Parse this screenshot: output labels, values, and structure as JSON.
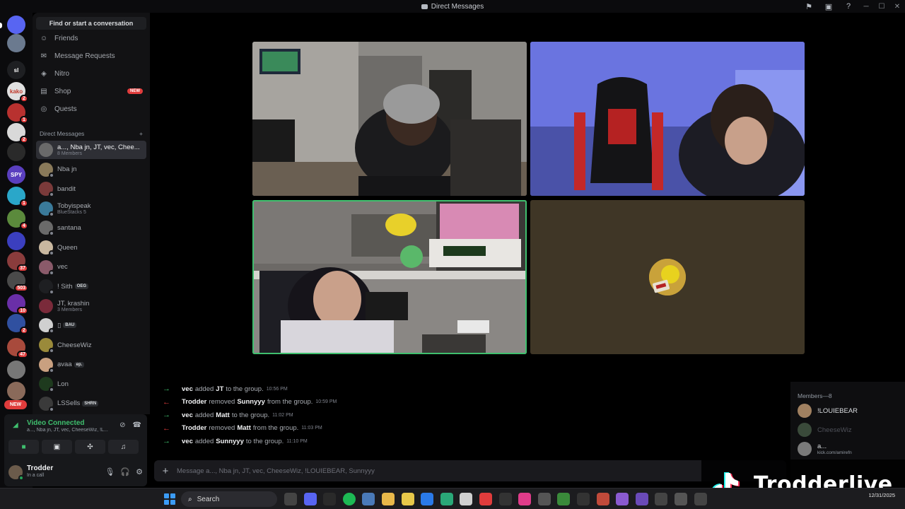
{
  "window": {
    "title": "Direct Messages"
  },
  "rail": {
    "servers": [
      {
        "label": "",
        "color": "#5865f2",
        "badge": ""
      },
      {
        "label": "",
        "color": "#6b7a8f",
        "badge": ""
      },
      {
        "label": "sl",
        "color": "#1e1f22",
        "badge": ""
      },
      {
        "label": "kako",
        "color": "#e0e0e0",
        "badge": "2"
      },
      {
        "label": "",
        "color": "#b8312f",
        "badge": "1"
      },
      {
        "label": "",
        "color": "#d9d9d9",
        "badge": "2"
      },
      {
        "label": "",
        "color": "#2a2a2a",
        "badge": ""
      },
      {
        "label": "SPY",
        "color": "#5a3fbf",
        "badge": ""
      },
      {
        "label": "",
        "color": "#2aa7c9",
        "badge": "1"
      },
      {
        "label": "",
        "color": "#5b8a3c",
        "badge": "4"
      },
      {
        "label": "",
        "color": "#3b3fbf",
        "badge": ""
      },
      {
        "label": "",
        "color": "#8a3c3c",
        "badge": "37"
      },
      {
        "label": "",
        "color": "#4a4a4a",
        "badge": "503"
      },
      {
        "label": "",
        "color": "#6a2fa8",
        "badge": "10"
      },
      {
        "label": "",
        "color": "#3050a0",
        "badge": "2"
      },
      {
        "label": "",
        "color": "#a84a3c",
        "badge": "47"
      },
      {
        "label": "",
        "color": "#777777",
        "badge": ""
      },
      {
        "label": "",
        "color": "#8a6a5a",
        "badge": ""
      }
    ],
    "new_label": "NEW"
  },
  "sidebar": {
    "search_placeholder": "Find or start a conversation",
    "nav": [
      {
        "label": "Friends",
        "icon": "friends-icon",
        "tag": ""
      },
      {
        "label": "Message Requests",
        "icon": "mail-icon",
        "tag": ""
      },
      {
        "label": "Nitro",
        "icon": "nitro-icon",
        "tag": ""
      },
      {
        "label": "Shop",
        "icon": "shop-icon",
        "tag": "NEW"
      },
      {
        "label": "Quests",
        "icon": "quests-icon",
        "tag": ""
      }
    ],
    "dm_header": "Direct Messages",
    "dms": [
      {
        "name": "a..., Nba jn, JT, vec, Chee...",
        "sub": "8 Members",
        "tag": "",
        "color": "#6a6a6a",
        "active": true
      },
      {
        "name": "Nba jn",
        "sub": "",
        "tag": "",
        "color": "#8a7a5a",
        "active": false
      },
      {
        "name": "bandit",
        "sub": "",
        "tag": "",
        "color": "#7a3a3a",
        "active": false
      },
      {
        "name": "Tobyispeak",
        "sub": "BlueStacks 5",
        "tag": "",
        "color": "#3a7a9a",
        "active": false
      },
      {
        "name": "santana",
        "sub": "",
        "tag": "",
        "color": "#6a6a6a",
        "active": false
      },
      {
        "name": "Queen",
        "sub": "",
        "tag": "",
        "color": "#c9b8a0",
        "active": false
      },
      {
        "name": "vec",
        "sub": "",
        "tag": "",
        "color": "#8a5a6a",
        "active": false
      },
      {
        "name": "! Sith",
        "sub": "",
        "tag": "OEG",
        "color": "#1e1f22",
        "active": false
      },
      {
        "name": "JT, krashin",
        "sub": "3 Members",
        "tag": "",
        "color": "#7a2a3a",
        "active": false
      },
      {
        "name": "▯",
        "sub": "",
        "tag": "BAU",
        "color": "#d0d0d0",
        "active": false
      },
      {
        "name": "CheeseWiz",
        "sub": "",
        "tag": "",
        "color": "#9a8a3a",
        "active": false
      },
      {
        "name": "ạvaa",
        "sub": "",
        "tag": "ep.",
        "color": "#c9a080",
        "active": false
      },
      {
        "name": "Lon",
        "sub": "",
        "tag": "",
        "color": "#1e3a1e",
        "active": false
      },
      {
        "name": "LSSells",
        "sub": "",
        "tag": "SHRN",
        "color": "#3a3a3a",
        "active": false
      }
    ]
  },
  "voice": {
    "status": "Video Connected",
    "channel": "a..., Nba jn, JT, vec, CheeseWiz, !L...",
    "buttons": [
      "camera-icon",
      "screen-share-icon",
      "activities-icon",
      "soundboard-icon"
    ]
  },
  "user": {
    "name": "Trodder",
    "status": "In a call"
  },
  "log": [
    {
      "dir": "in",
      "actor": "vec",
      "verb": "added",
      "target": "JT",
      "rest": "to the group.",
      "time": "10:56 PM"
    },
    {
      "dir": "out",
      "actor": "Trodder",
      "verb": "removed",
      "target": "Sunnyyy",
      "rest": "from the group.",
      "time": "10:59 PM"
    },
    {
      "dir": "in",
      "actor": "vec",
      "verb": "added",
      "target": "Matt",
      "rest": "to the group.",
      "time": "11:02 PM"
    },
    {
      "dir": "out",
      "actor": "Trodder",
      "verb": "removed",
      "target": "Matt",
      "rest": "from the group.",
      "time": "11:03 PM"
    },
    {
      "dir": "in",
      "actor": "vec",
      "verb": "added",
      "target": "Sunnyyy",
      "rest": "to the group.",
      "time": "11:10 PM"
    }
  ],
  "composer": {
    "placeholder": "Message a..., Nba jn, JT, vec, CheeseWiz, !LOUIEBEAR, Sunnyyy"
  },
  "members": {
    "header": "Members—8",
    "list": [
      {
        "name": "!LOUIEBEAR",
        "sub": "",
        "faded": false,
        "color": "#a08060"
      },
      {
        "name": "CheeseWiz",
        "sub": "",
        "faded": true,
        "color": "#3a4a3a"
      },
      {
        "name": "a...",
        "sub": "kick.com/amirefn",
        "faded": false,
        "color": "#7a7a7a"
      }
    ]
  },
  "watermark": {
    "text": "Trodderlive"
  },
  "taskbar": {
    "search_label": "Search",
    "date": "12/31/2025"
  },
  "colors": {
    "accent": "#5865f2",
    "online": "#23a55a",
    "speaking": "#3fbf6e",
    "danger": "#e03c3c"
  }
}
